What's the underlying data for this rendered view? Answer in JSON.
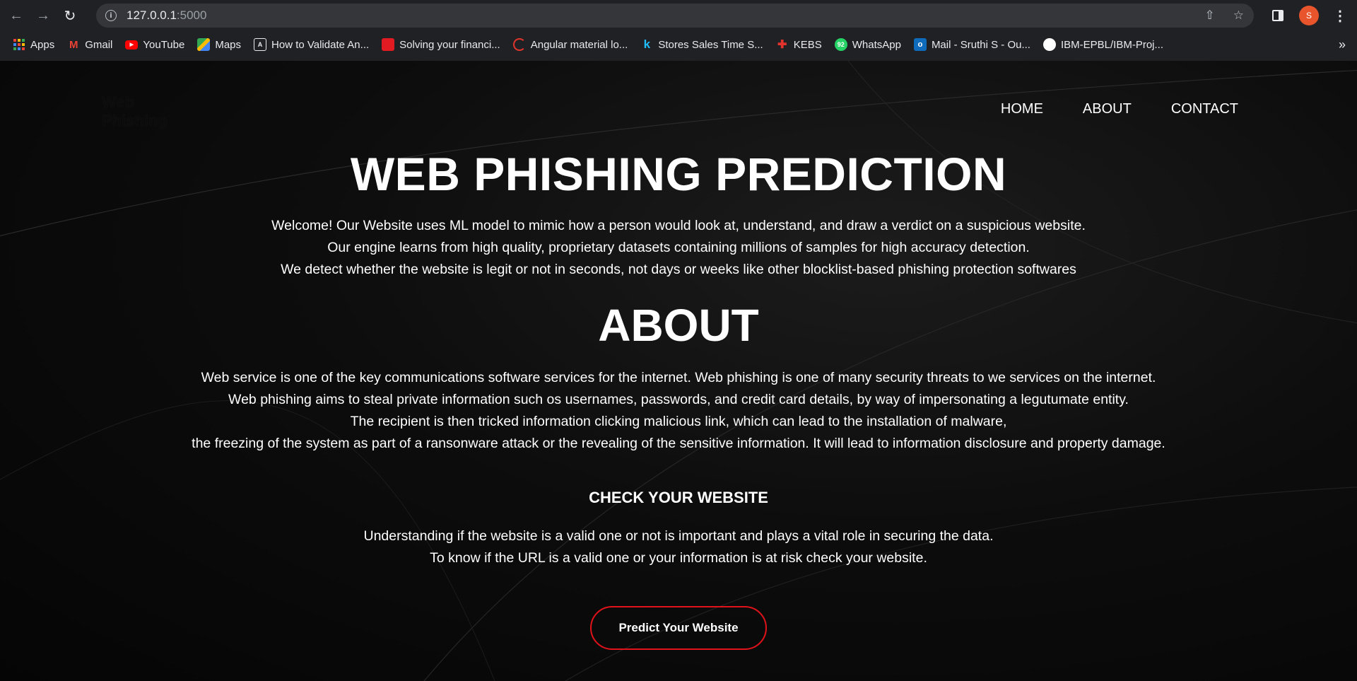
{
  "browser": {
    "url_host": "127.0.0.1",
    "url_port": ":5000",
    "profile_initial": "S"
  },
  "bookmarks": [
    {
      "label": "Apps",
      "icon": "apps-grid-icon"
    },
    {
      "label": "Gmail",
      "icon": "gmail-icon",
      "color": "#ea4335"
    },
    {
      "label": "YouTube",
      "icon": "youtube-icon",
      "color": "#ff0000"
    },
    {
      "label": "Maps",
      "icon": "maps-icon",
      "color": "#34a853"
    },
    {
      "label": "How to Validate An...",
      "icon": "angular-icon",
      "color": "#1e1e2e"
    },
    {
      "label": "Solving your financi...",
      "icon": "bookmark-flag-icon",
      "color": "#e21b22"
    },
    {
      "label": "Angular material lo...",
      "icon": "angular-c-icon",
      "color": "#e0352b"
    },
    {
      "label": "Stores Sales Time S...",
      "icon": "kaggle-icon",
      "color": "#20beff"
    },
    {
      "label": "KEBS",
      "icon": "kebs-icon",
      "color": "#e2332c"
    },
    {
      "label": "WhatsApp",
      "icon": "whatsapp-icon",
      "color": "#25d366",
      "badge": "92"
    },
    {
      "label": "Mail - Sruthi S - Ou...",
      "icon": "outlook-icon",
      "color": "#0f6cbd"
    },
    {
      "label": "IBM-EPBL/IBM-Proj...",
      "icon": "github-icon",
      "color": "#ffffff"
    }
  ],
  "site": {
    "logo": [
      "Web",
      "Phishing"
    ],
    "nav": [
      "HOME",
      "ABOUT",
      "CONTACT"
    ],
    "title": "WEB PHISHING PREDICTION",
    "welcome_lines": [
      "Welcome! Our Website uses ML model to mimic how a person would look at, understand, and draw a verdict on a suspicious website.",
      "Our engine learns from high quality, proprietary datasets containing millions of samples for high accuracy detection.",
      "We detect whether the website is legit or not in seconds, not days or weeks like other blocklist-based phishing protection softwares"
    ],
    "about_title": "ABOUT",
    "about_lines": [
      "Web service is one of the key communications software services for the internet. Web phishing is one of many security threats to we services on the internet.",
      "Web phishing aims to steal private information such os usernames, passwords, and credit card details, by way of impersonating a legutumate entity.",
      "The recipient is then tricked information clicking malicious link, which can lead to the installation of malware,",
      "the freezing of the system as part of a ransonware attack or the revealing of the sensitive information. It will lead to information disclosure and property damage."
    ],
    "check_title": "CHECK YOUR WEBSITE",
    "check_lines": [
      "Understanding if the website is a valid one or not is important and plays a vital role in securing the data.",
      "To know if the URL is a valid one or your information is at risk check your website."
    ],
    "predict_button": "Predict Your Website",
    "accent_color": "#e0131a"
  }
}
